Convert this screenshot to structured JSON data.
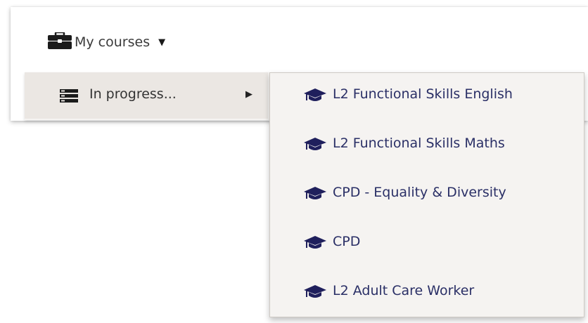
{
  "nav": {
    "my_courses_label": "My courses",
    "my_courses_icon": "briefcase-icon",
    "caret_icon": "caret-down-icon"
  },
  "submenu": {
    "in_progress_label": "In progress...",
    "in_progress_icon": "list-icon",
    "arrow_icon": "caret-right-icon"
  },
  "courses": {
    "icon": "graduation-cap-icon",
    "items": [
      {
        "label": "L2 Functional Skills English"
      },
      {
        "label": "L2 Functional Skills Maths"
      },
      {
        "label": "CPD - Equality & Diversity"
      },
      {
        "label": "CPD"
      },
      {
        "label": "L2 Adult Care Worker"
      }
    ]
  },
  "colors": {
    "menu_bg": "#f5f3f1",
    "hover_bg": "#ebe7e3",
    "course_text": "#2a2f66",
    "icon_navy": "#1f1f5c"
  }
}
